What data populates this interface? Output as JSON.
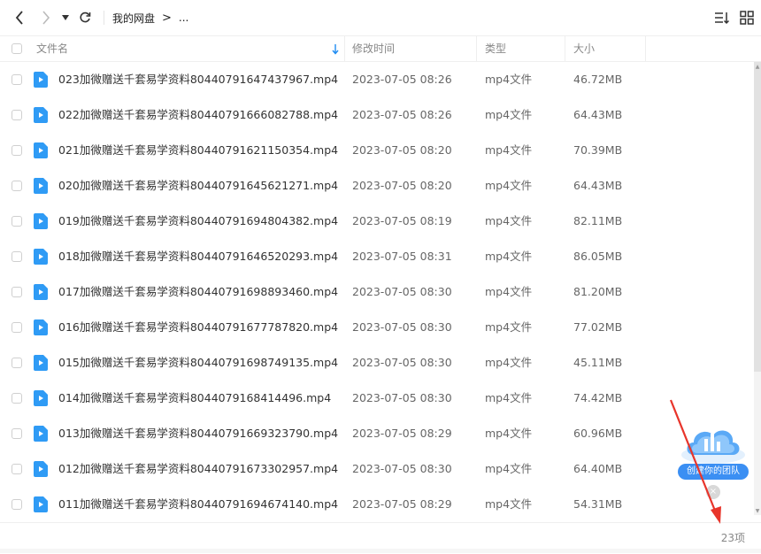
{
  "breadcrumb": {
    "root": "我的网盘",
    "more": "..."
  },
  "header": {
    "name": "文件名",
    "modified": "修改时间",
    "type": "类型",
    "size": "大小"
  },
  "files": [
    {
      "name": "023加微赠送千套易学资料80440791647437967.mp4",
      "modified": "2023-07-05 08:26",
      "type": "mp4文件",
      "size": "46.72MB"
    },
    {
      "name": "022加微赠送千套易学资料80440791666082788.mp4",
      "modified": "2023-07-05 08:26",
      "type": "mp4文件",
      "size": "64.43MB"
    },
    {
      "name": "021加微赠送千套易学资料80440791621150354.mp4",
      "modified": "2023-07-05 08:20",
      "type": "mp4文件",
      "size": "70.39MB"
    },
    {
      "name": "020加微赠送千套易学资料80440791645621271.mp4",
      "modified": "2023-07-05 08:20",
      "type": "mp4文件",
      "size": "64.43MB"
    },
    {
      "name": "019加微赠送千套易学资料80440791694804382.mp4",
      "modified": "2023-07-05 08:19",
      "type": "mp4文件",
      "size": "82.11MB"
    },
    {
      "name": "018加微赠送千套易学资料80440791646520293.mp4",
      "modified": "2023-07-05 08:31",
      "type": "mp4文件",
      "size": "86.05MB"
    },
    {
      "name": "017加微赠送千套易学资料80440791698893460.mp4",
      "modified": "2023-07-05 08:30",
      "type": "mp4文件",
      "size": "81.20MB"
    },
    {
      "name": "016加微赠送千套易学资料80440791677787820.mp4",
      "modified": "2023-07-05 08:30",
      "type": "mp4文件",
      "size": "77.02MB"
    },
    {
      "name": "015加微赠送千套易学资料80440791698749135.mp4",
      "modified": "2023-07-05 08:30",
      "type": "mp4文件",
      "size": "45.11MB"
    },
    {
      "name": "014加微赠送千套易学资料8044079168414496.mp4",
      "modified": "2023-07-05 08:30",
      "type": "mp4文件",
      "size": "74.42MB"
    },
    {
      "name": "013加微赠送千套易学资料80440791669323790.mp4",
      "modified": "2023-07-05 08:29",
      "type": "mp4文件",
      "size": "60.96MB"
    },
    {
      "name": "012加微赠送千套易学资料80440791673302957.mp4",
      "modified": "2023-07-05 08:30",
      "type": "mp4文件",
      "size": "64.40MB"
    },
    {
      "name": "011加微赠送千套易学资料80440791694674140.mp4",
      "modified": "2023-07-05 08:29",
      "type": "mp4文件",
      "size": "54.31MB"
    }
  ],
  "footer": {
    "count": "23项"
  },
  "promo": {
    "label": "创建你的团队"
  },
  "colors": {
    "accent": "#1f8cf2",
    "icon_blue": "#2f9bf5",
    "annotation_red": "#e8352b"
  }
}
